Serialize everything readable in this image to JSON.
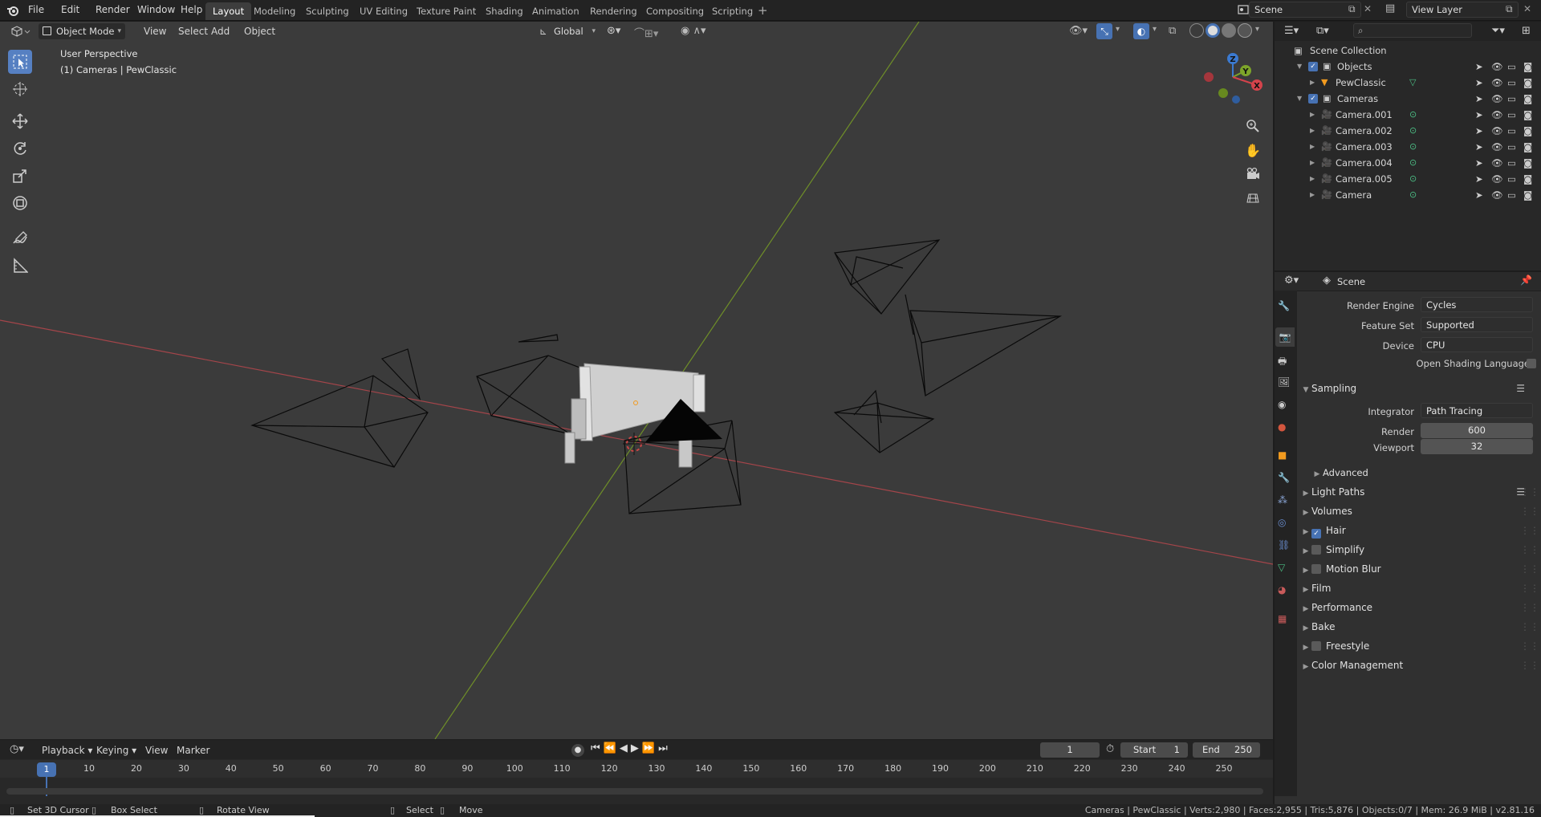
{
  "menus": [
    "File",
    "Edit",
    "Render",
    "Window",
    "Help"
  ],
  "workspaces": [
    "Layout",
    "Modeling",
    "Sculpting",
    "UV Editing",
    "Texture Paint",
    "Shading",
    "Animation",
    "Rendering",
    "Compositing",
    "Scripting"
  ],
  "active_workspace": "Layout",
  "scene_field": "Scene",
  "viewlayer_field": "View Layer",
  "viewport": {
    "mode": "Object Mode",
    "menus": [
      "View",
      "Select",
      "Add",
      "Object"
    ],
    "orientation": "Global",
    "overlay_title": "User Perspective",
    "overlay_sub": "(1) Cameras | PewClassic"
  },
  "outliner": {
    "root": "Scene Collection",
    "rows": [
      {
        "label": "Objects",
        "type": "collection",
        "level": 1
      },
      {
        "label": "PewClassic",
        "type": "mesh",
        "level": 2
      },
      {
        "label": "Cameras",
        "type": "collection",
        "level": 1
      },
      {
        "label": "Camera.001",
        "type": "camera",
        "level": 2
      },
      {
        "label": "Camera.002",
        "type": "camera",
        "level": 2
      },
      {
        "label": "Camera.003",
        "type": "camera",
        "level": 2
      },
      {
        "label": "Camera.004",
        "type": "camera",
        "level": 2
      },
      {
        "label": "Camera.005",
        "type": "camera",
        "level": 2
      },
      {
        "label": "Camera",
        "type": "camera",
        "level": 2
      }
    ]
  },
  "properties": {
    "context": "Scene",
    "render_engine_label": "Render Engine",
    "render_engine": "Cycles",
    "feature_set_label": "Feature Set",
    "feature_set": "Supported",
    "device_label": "Device",
    "device": "CPU",
    "osl_label": "Open Shading Language",
    "sampling": "Sampling",
    "integrator_label": "Integrator",
    "integrator": "Path Tracing",
    "render_label": "Render",
    "render_samples": "600",
    "viewport_label": "Viewport",
    "viewport_samples": "32",
    "advanced": "Advanced",
    "sections": [
      {
        "label": "Light Paths",
        "checkbox": null
      },
      {
        "label": "Volumes",
        "checkbox": null
      },
      {
        "label": "Hair",
        "checkbox": true
      },
      {
        "label": "Simplify",
        "checkbox": false
      },
      {
        "label": "Motion Blur",
        "checkbox": false
      },
      {
        "label": "Film",
        "checkbox": null
      },
      {
        "label": "Performance",
        "checkbox": null
      },
      {
        "label": "Bake",
        "checkbox": null
      },
      {
        "label": "Freestyle",
        "checkbox": false
      },
      {
        "label": "Color Management",
        "checkbox": null
      }
    ]
  },
  "timeline": {
    "menus": [
      "Playback",
      "Keying",
      "View",
      "Marker"
    ],
    "current_frame": "1",
    "start_label": "Start",
    "start": "1",
    "end_label": "End",
    "end": "250",
    "ticks": [
      "1",
      "10",
      "20",
      "30",
      "40",
      "50",
      "60",
      "70",
      "80",
      "90",
      "100",
      "110",
      "120",
      "130",
      "140",
      "150",
      "160",
      "170",
      "180",
      "190",
      "200",
      "210",
      "220",
      "230",
      "240",
      "250"
    ]
  },
  "status": {
    "hints": [
      "Set 3D Cursor",
      "Box Select",
      "Rotate View",
      "Select",
      "Move"
    ],
    "info": "Cameras | PewClassic | Verts:2,980 | Faces:2,955 | Tris:5,876 | Objects:0/7 | Mem: 26.9 MiB | v2.81.16"
  }
}
